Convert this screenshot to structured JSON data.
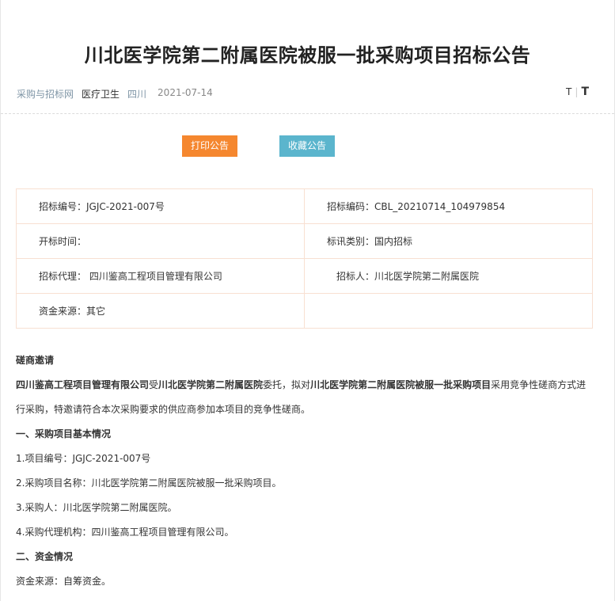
{
  "title": "川北医学院第二附属医院被服一批采购项目招标公告",
  "meta": {
    "source": "采购与招标网",
    "industry": "医疗卫生",
    "region": "四川",
    "date": "2021-07-14",
    "font_small": "T",
    "font_large": "T"
  },
  "buttons": {
    "print": "打印公告",
    "favorite": "收藏公告"
  },
  "info_table": {
    "bid_no": "招标编号：JGJC-2021-007号",
    "bid_code": "招标编码：CBL_20210714_104979854",
    "open_time": "开标时间：",
    "category": "标讯类别：国内招标",
    "agent": "招标代理： 四川鉴高工程项目管理有限公司",
    "tenderer": "招标人：川北医学院第二附属医院",
    "fund_source": "资金来源：其它"
  },
  "content": {
    "heading": "磋商邀请",
    "intro_agent": "四川鉴高工程项目管理有限公司",
    "intro_mid1": "受",
    "intro_client": "川北医学院第二附属医院",
    "intro_mid2": "委托，拟对",
    "intro_project": "川北医学院第二附属医院被服一批采购项目",
    "intro_tail": "采用竞争性磋商方式进",
    "intro_line2": "行采购，特邀请符合本次采购要求的供应商参加本项目的竞争性磋商。",
    "section1": "一、采购项目基本情况",
    "item1": "1.项目编号：JGJC-2021-007号",
    "item2": "2.采购项目名称：川北医学院第二附属医院被服一批采购项目。",
    "item3": "3.采购人：川北医学院第二附属医院。",
    "item4": "4.采购代理机构：四川鉴高工程项目管理有限公司。",
    "section2": "二、资金情况",
    "fund_text": "资金来源：自筹资金。"
  }
}
